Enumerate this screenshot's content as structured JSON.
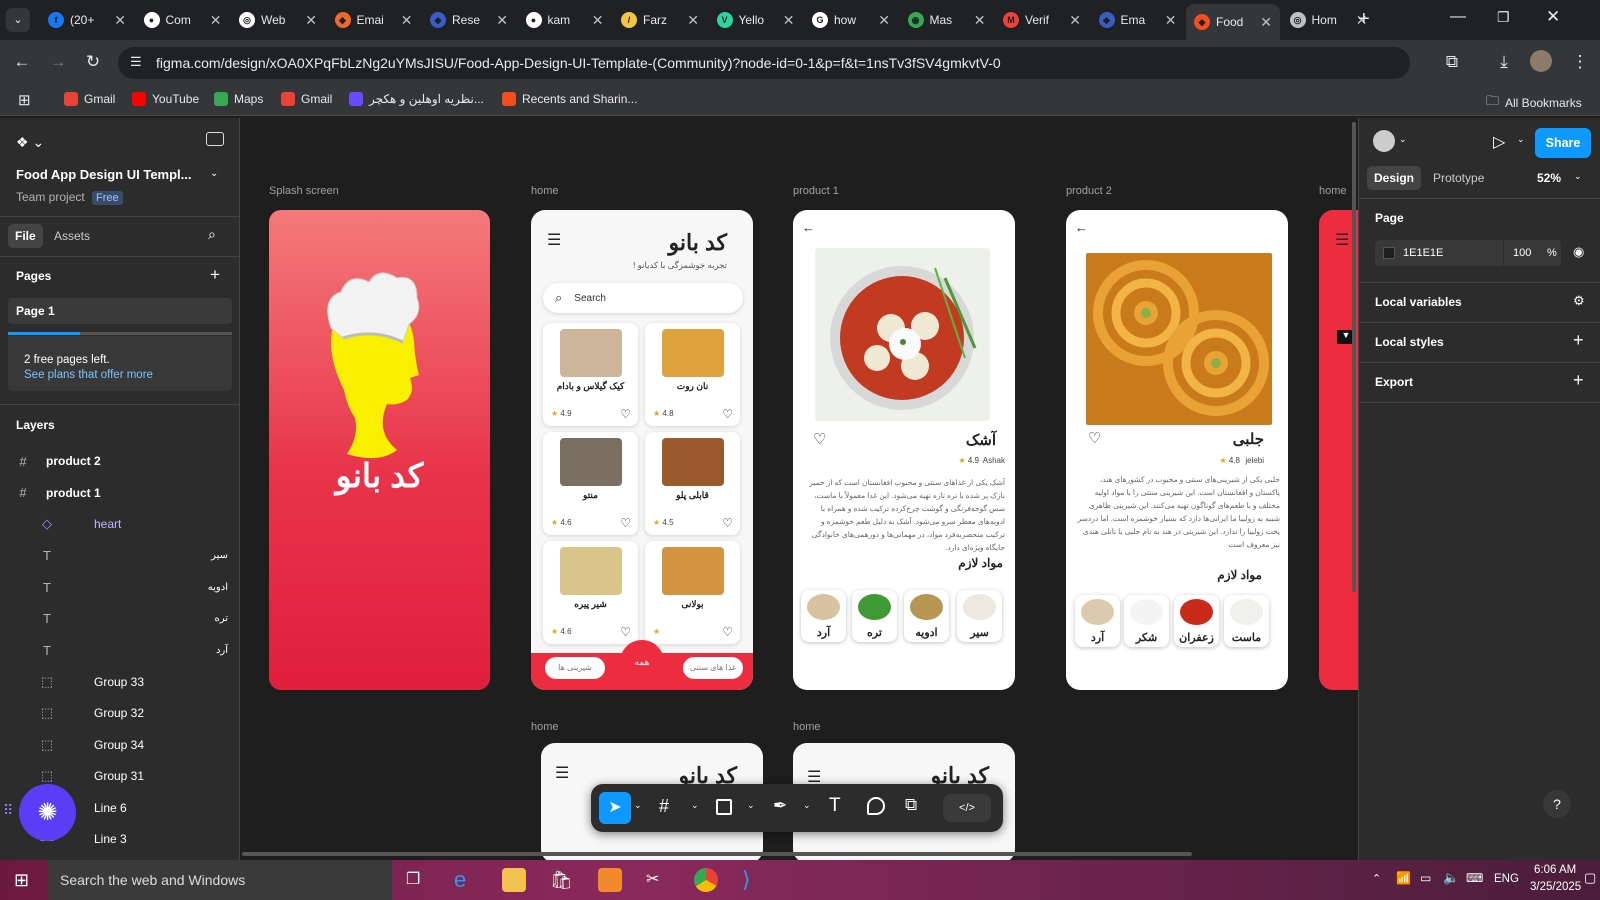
{
  "browser": {
    "tabs": [
      {
        "title": "(20+",
        "color": "#1877f2",
        "glyph": "f"
      },
      {
        "title": "Com",
        "color": "#ffffff",
        "glyph": "●"
      },
      {
        "title": "Web",
        "color": "#ffffff",
        "glyph": "◎"
      },
      {
        "title": "Emai",
        "color": "#f06a2c",
        "glyph": "◆"
      },
      {
        "title": "Rese",
        "color": "#3b5cc4",
        "glyph": "◆"
      },
      {
        "title": "kam",
        "color": "#ffffff",
        "glyph": "●"
      },
      {
        "title": "Farz",
        "color": "#f4c542",
        "glyph": "/"
      },
      {
        "title": "Yello",
        "color": "#2bd4a0",
        "glyph": "V"
      },
      {
        "title": "how",
        "color": "#ffffff",
        "glyph": "G"
      },
      {
        "title": "Mas",
        "color": "#34a853",
        "glyph": "◉"
      },
      {
        "title": "Verif",
        "color": "#ea4335",
        "glyph": "M"
      },
      {
        "title": "Ema",
        "color": "#3b5cc4",
        "glyph": "◆"
      },
      {
        "title": "Food",
        "color": "#f24e1e",
        "glyph": "◆"
      },
      {
        "title": "Hom",
        "color": "#bdc1c6",
        "glyph": "◎"
      }
    ],
    "active_tab": 12,
    "url": "figma.com/design/xOA0XPqFbLzNg2uYMsJISU/Food-App-Design-UI-Template-(Community)?node-id=0-1&p=f&t=1nsTv3fSV4gmkvtV-0",
    "bookmarks": [
      {
        "label": "Gmail",
        "color": "#ea4335"
      },
      {
        "label": "YouTube",
        "color": "#ff0000"
      },
      {
        "label": "Maps",
        "color": "#34a853"
      },
      {
        "label": "Gmail",
        "color": "#ea4335"
      },
      {
        "label": "نظریه اوهلین و هکچر...",
        "color": "#6a4cff"
      },
      {
        "label": "Recents and Sharin...",
        "color": "#f24e1e"
      }
    ],
    "all_bookmarks": "All Bookmarks"
  },
  "figma_left": {
    "file_title": "Food App Design UI Templ...",
    "team": "Team project",
    "plan_badge": "Free",
    "tab_file": "File",
    "tab_assets": "Assets",
    "pages_header": "Pages",
    "page1": "Page 1",
    "free_pages": "2 free pages left.",
    "see_plans": "See plans that offer more",
    "layers_header": "Layers",
    "layers": [
      {
        "name": "product 2",
        "icon": "#",
        "indent": false,
        "bold": true
      },
      {
        "name": "product 1",
        "icon": "#",
        "indent": false,
        "bold": true
      },
      {
        "name": "heart",
        "icon": "◇",
        "indent": true,
        "purple": true
      },
      {
        "name": "سیر",
        "icon": "T",
        "indent": true,
        "rtl": true
      },
      {
        "name": "ادویه",
        "icon": "T",
        "indent": true,
        "rtl": true
      },
      {
        "name": "تره",
        "icon": "T",
        "indent": true,
        "rtl": true
      },
      {
        "name": "آرد",
        "icon": "T",
        "indent": true,
        "rtl": true
      },
      {
        "name": "Group 33",
        "icon": "⬚",
        "indent": true
      },
      {
        "name": "Group 32",
        "icon": "⬚",
        "indent": true
      },
      {
        "name": "Group 34",
        "icon": "⬚",
        "indent": true
      },
      {
        "name": "Group 31",
        "icon": "⬚",
        "indent": true
      },
      {
        "name": "Line 6",
        "icon": "—",
        "indent": true
      },
      {
        "name": "Line 3",
        "icon": "—",
        "indent": true
      }
    ]
  },
  "canvas": {
    "labels": {
      "splash": "Splash screen",
      "home": "home",
      "product1": "product 1",
      "product2": "product 2",
      "home_cut": "home",
      "home2": "home",
      "home3": "home"
    },
    "brand": "کد بانو",
    "tagline": "تجربه خوشمزگی با کدبانو !",
    "search": "Search",
    "foods": [
      {
        "name": "کیک گیلاس و بادام",
        "rating": "4.9"
      },
      {
        "name": "نان روت",
        "rating": "4.8"
      },
      {
        "name": "منتو",
        "rating": "4.6"
      },
      {
        "name": "قابلی پلو",
        "rating": "4.5"
      },
      {
        "name": "شیر پیره",
        "rating": "4.6"
      },
      {
        "name": "بولانی",
        "rating": ""
      }
    ],
    "bottom_tabs": {
      "sweets": "شیرینی ها",
      "all": "همه",
      "traditional": "غذا های سنتی"
    },
    "product1": {
      "title": "آشک",
      "rating": "4.9",
      "latin": "Ashak",
      "desc": "آشک یکی از غذاهای سنتی و محبوب افغانستان است که از خمیر نازک پر شده با تره تازه تهیه می‌شود. این غذا معمولاً با ماست، سس گوجه‌فرنگی و گوشت چرخ‌کرده ترکیب شده و همراه با ادویه‌های معطر سرو می‌شود. آشک به دلیل طعم خوشمزه و ترکیب منحصربه‌فرد مواد، در مهمانی‌ها و دورهمی‌های خانوادگی جایگاه ویژه‌ای دارد.",
      "ingredients_title": "مواد لازم",
      "ingredients": [
        "آرد",
        "تره",
        "ادویه",
        "سیر"
      ]
    },
    "product2": {
      "title": "جلبی",
      "rating": "4.8",
      "latin": "jelebi",
      "desc": "جلبی یکی از شیرینی‌های سنتی و محبوب در کشورهای هند، پاکستان و افغانستان است. این شیرینی سنتی را با مواد اولیه مختلف و با طعم‌های گوناگون تهیه می‌کنند. این شیرینی ظاهری شبیه به زولبیا ما ایرانی‌ها دارد که بسیار خوشمزه است. اما دردسر پخت زولبیا را ندارد. این شیرینی در هند به نام جلبی یا تانلی هندی نیز معروف است",
      "ingredients_title": "مواد لازم",
      "ingredients": [
        "آرد",
        "شکر",
        "زعفران",
        "ماست"
      ]
    }
  },
  "figma_right": {
    "share": "Share",
    "tab_design": "Design",
    "tab_prototype": "Prototype",
    "zoom": "52%",
    "page_header": "Page",
    "bg_hex": "1E1E1E",
    "bg_opacity": "100",
    "pct": "%",
    "local_variables": "Local variables",
    "local_styles": "Local styles",
    "export": "Export",
    "help": "?"
  },
  "taskbar": {
    "search_placeholder": "Search the web and Windows",
    "lang": "ENG",
    "time": "6:06 AM",
    "date": "3/25/2025"
  }
}
